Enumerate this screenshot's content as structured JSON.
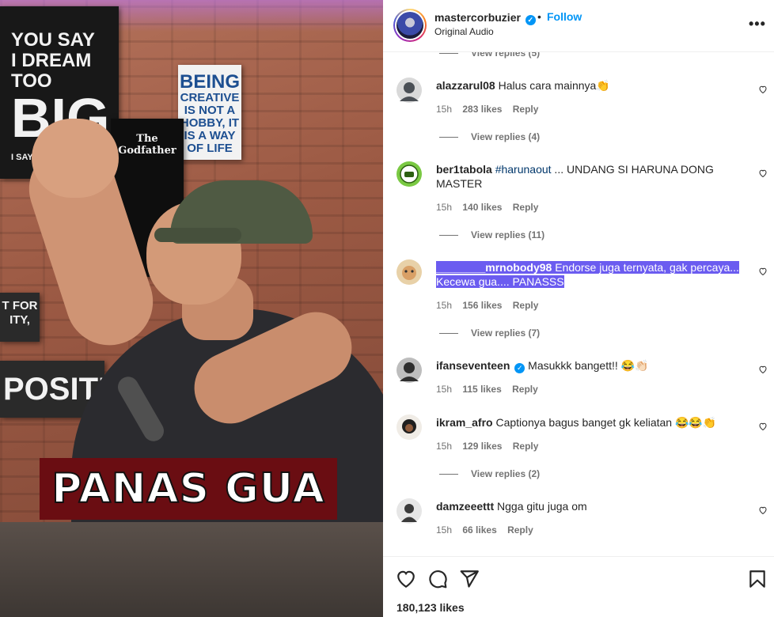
{
  "media": {
    "caption": "PANAS GUA",
    "posters": {
      "dream_small": "YOU SAY",
      "dream_mid": "I DREAM TOO",
      "dream_big": "BIG",
      "dream_tail": "I SAY YOU... SMALL.",
      "creative_top": "BEING",
      "creative_body": "CREATIVE IS NOT A HOBBY, IT IS A WAY OF LIFE",
      "godfather": "The Godfather",
      "positive": "POSITIVE",
      "for": "T FOR ITY,"
    }
  },
  "header": {
    "username": "mastercorbuzier",
    "verified_glyph": "✓",
    "separator": "•",
    "follow_label": "Follow",
    "audio_label": "Original Audio",
    "more_glyph": "•••"
  },
  "comments": [
    {
      "view_replies_above": "View replies (5)"
    },
    {
      "username": "alazzarul08",
      "text": "Halus cara mainnya👏",
      "time": "15h",
      "likes": "283 likes",
      "reply": "Reply",
      "view_replies": "View replies (4)",
      "avatar_color": "#4a4f55"
    },
    {
      "username": "ber1tabola",
      "hashtag": "#harunaout",
      "text": " ... UNDANG SI HARUNA DONG MASTER",
      "time": "15h",
      "likes": "140 likes",
      "reply": "Reply",
      "view_replies": "View replies (11)",
      "avatar_color": "#7ac943"
    },
    {
      "username": "________mrnobody98",
      "text": "Endorse juga ternyata, gak percaya... Kecewa gua.... PANASSS",
      "time": "15h",
      "likes": "156 likes",
      "reply": "Reply",
      "view_replies": "View replies (7)",
      "avatar_color": "#d9a066",
      "highlight_color": "#6b5cf0"
    },
    {
      "username": "ifanseventeen",
      "verified_glyph": "✓",
      "text": "Masukkk bangett!! 😂👏🏻",
      "time": "15h",
      "likes": "115 likes",
      "reply": "Reply",
      "avatar_color": "#2e2e2e"
    },
    {
      "username": "ikram_afro",
      "text": "Captionya bagus banget gk keliatan 😂😂👏",
      "time": "15h",
      "likes": "129 likes",
      "reply": "Reply",
      "view_replies": "View replies (2)",
      "avatar_color": "#1f1f1f"
    },
    {
      "username": "damzeeettt",
      "text": "Ngga gitu juga om",
      "time": "15h",
      "likes": "66 likes",
      "reply": "Reply",
      "avatar_color": "#3a3a3a"
    }
  ],
  "actions": {
    "like_icon": "heart-icon",
    "comment_icon": "comment-icon",
    "share_icon": "share-icon",
    "save_icon": "bookmark-icon",
    "likes_total": "180,123 likes"
  },
  "colors": {
    "accent": "#0095f6",
    "text_primary": "#262626",
    "text_secondary": "#737373",
    "caption_bg": "#6a0d12"
  }
}
